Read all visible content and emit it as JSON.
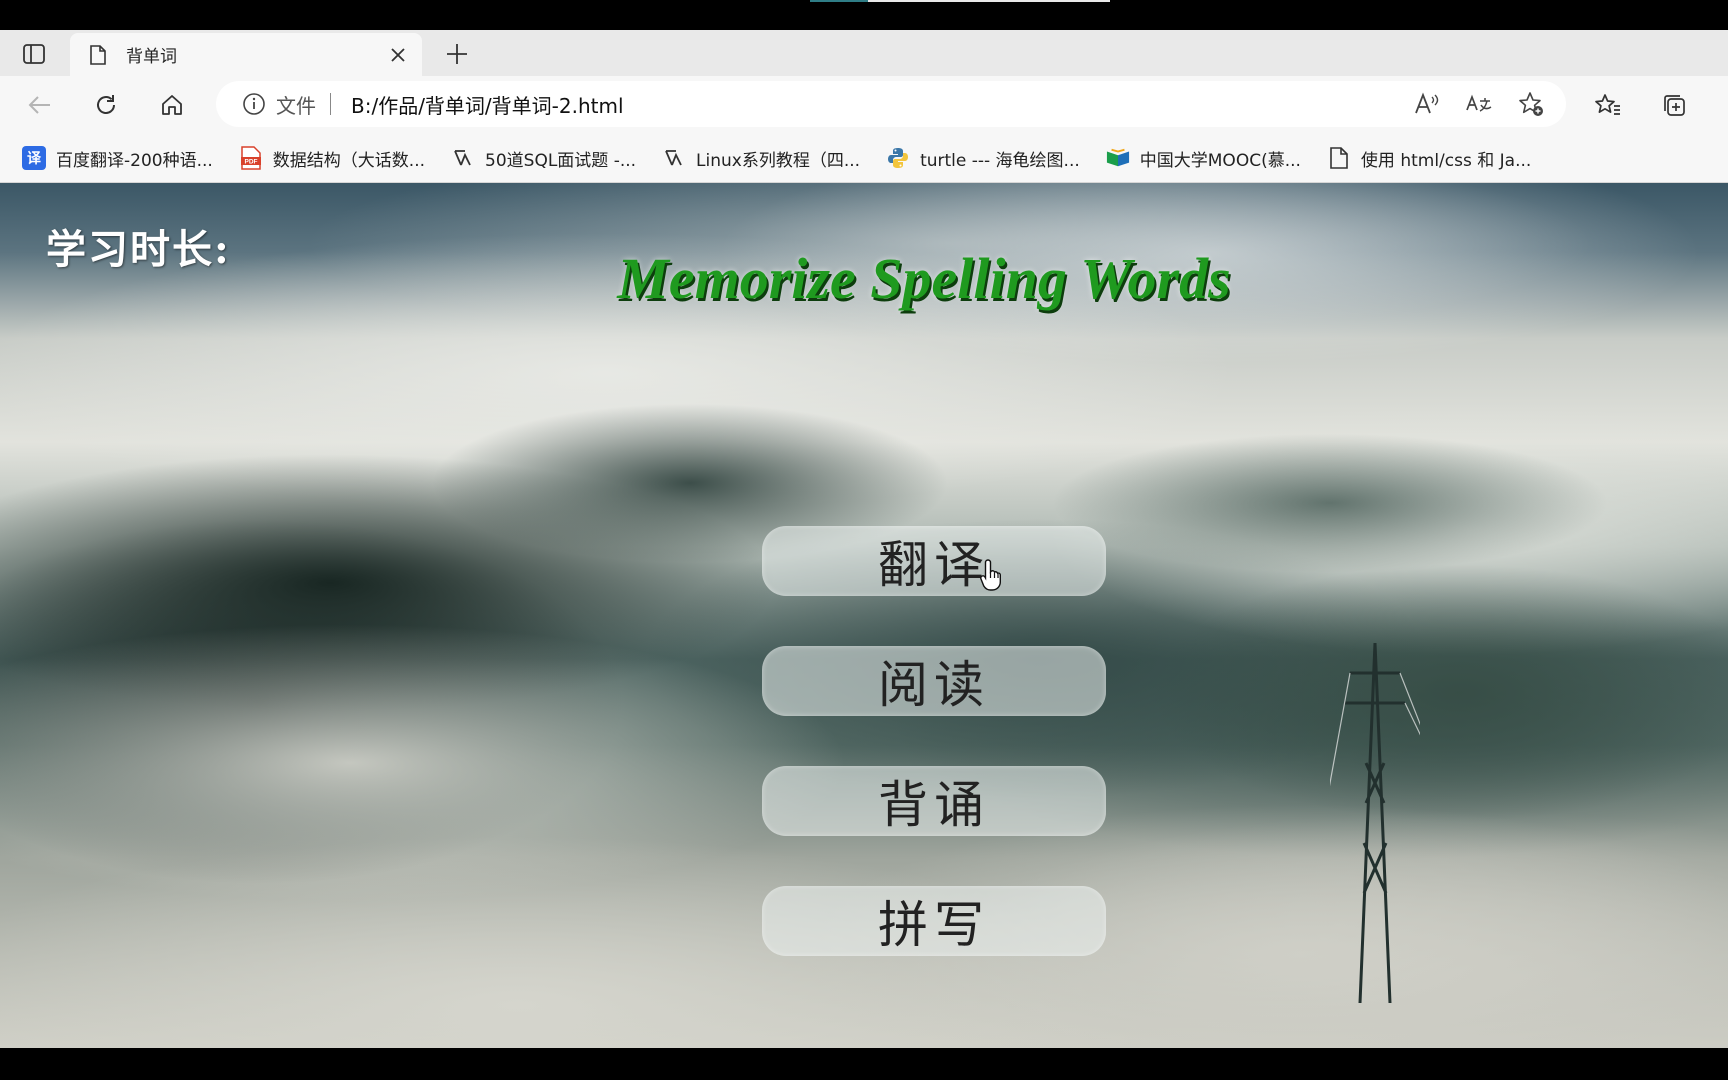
{
  "browser": {
    "tab": {
      "title": "背单词"
    },
    "address": {
      "scheme_label": "文件",
      "url": "B:/作品/背单词/背单词-2.html"
    },
    "bookmarks": [
      {
        "label": "百度翻译-200种语...",
        "icon": "baidu-translate-icon",
        "color": "#2d6be4"
      },
      {
        "label": "数据结构（大话数...",
        "icon": "pdf-icon",
        "color": "#d9412b"
      },
      {
        "label": "50道SQL面试题 -...",
        "icon": "csdn-icon",
        "color": "#333333"
      },
      {
        "label": "Linux系列教程（四...",
        "icon": "csdn-icon",
        "color": "#333333"
      },
      {
        "label": "turtle --- 海龟绘图...",
        "icon": "python-icon",
        "color": "#3b77a8"
      },
      {
        "label": "中国大学MOOC(慕...",
        "icon": "mooc-icon",
        "color": "#1b9e4b"
      },
      {
        "label": "使用 html/css 和 Ja...",
        "icon": "page-icon",
        "color": "#333333"
      }
    ]
  },
  "page": {
    "study_time_label": "学习时长:",
    "title": "Memorize Spelling Words",
    "menu": [
      {
        "label": "翻译"
      },
      {
        "label": "阅读"
      },
      {
        "label": "背诵"
      },
      {
        "label": "拼写"
      }
    ]
  }
}
